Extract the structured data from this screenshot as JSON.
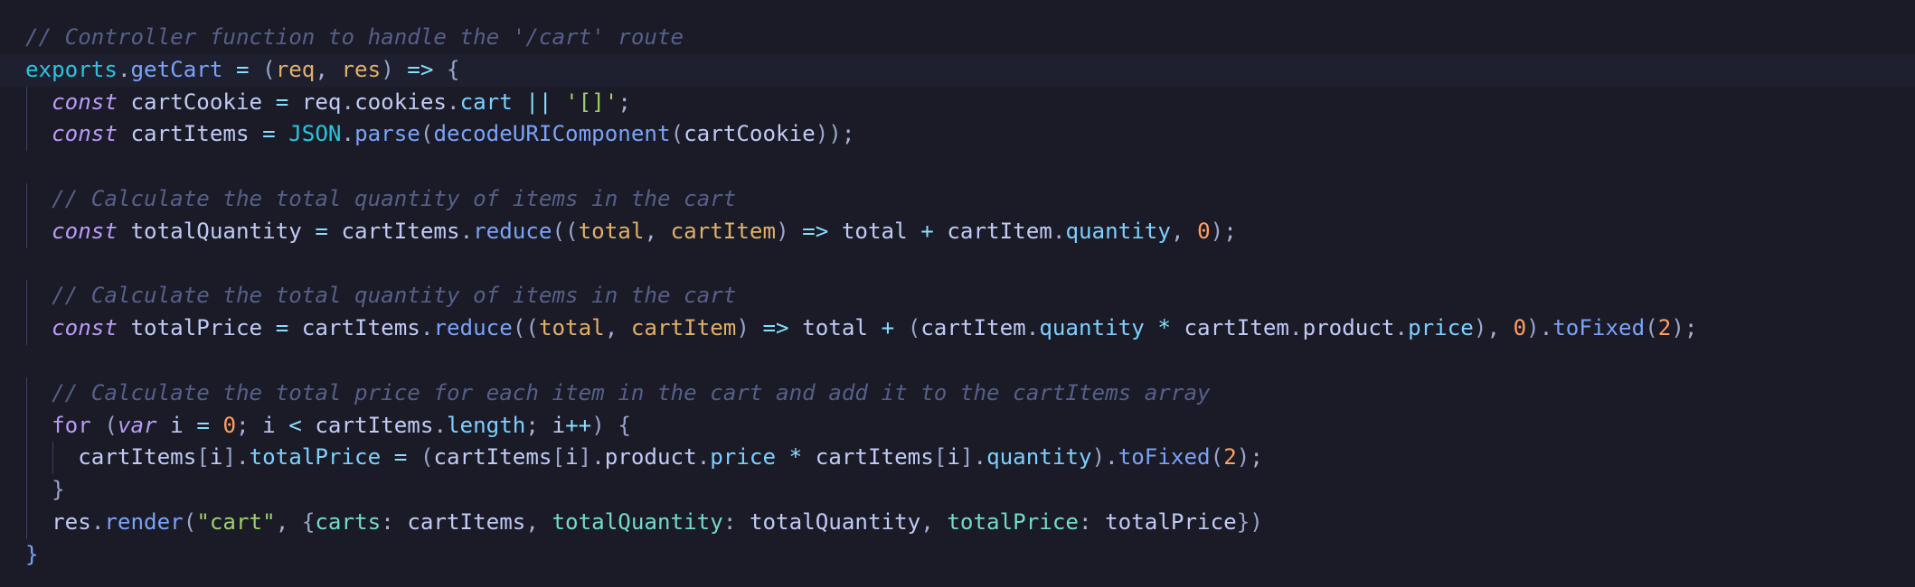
{
  "editor": {
    "language": "javascript",
    "theme_colors": {
      "background": "#1a1b26",
      "active_line": "#1e2030",
      "comment": "#565f89",
      "keyword": "#bb9af7",
      "string": "#9ece6a",
      "number": "#ff9e64",
      "function": "#7aa2f7",
      "property": "#7dcfff",
      "parameter": "#e0af68"
    },
    "lines": [
      {
        "indent": 0,
        "tokens": [
          [
            "comment",
            "// Controller function to handle the '/cart' route"
          ]
        ]
      },
      {
        "indent": 0,
        "active": true,
        "tokens": [
          [
            "exports",
            "exports"
          ],
          [
            "punct",
            "."
          ],
          [
            "func",
            "getCart"
          ],
          [
            "op",
            " = "
          ],
          [
            "bracket",
            "("
          ],
          [
            "param",
            "req"
          ],
          [
            "punct",
            ", "
          ],
          [
            "param",
            "res"
          ],
          [
            "bracket",
            ")"
          ],
          [
            "op",
            " => "
          ],
          [
            "bracket",
            "{"
          ]
        ]
      },
      {
        "indent": 1,
        "tokens": [
          [
            "keyword",
            "const"
          ],
          [
            "var",
            " cartCookie "
          ],
          [
            "op",
            "="
          ],
          [
            "var",
            " req"
          ],
          [
            "punct",
            "."
          ],
          [
            "var",
            "cookies"
          ],
          [
            "punct",
            "."
          ],
          [
            "prop",
            "cart"
          ],
          [
            "op",
            " || "
          ],
          [
            "string",
            "'[]'"
          ],
          [
            "punct",
            ";"
          ]
        ]
      },
      {
        "indent": 1,
        "tokens": [
          [
            "keyword",
            "const"
          ],
          [
            "var",
            " cartItems "
          ],
          [
            "op",
            "="
          ],
          [
            "var",
            " "
          ],
          [
            "builtin",
            "JSON"
          ],
          [
            "punct",
            "."
          ],
          [
            "func",
            "parse"
          ],
          [
            "bracket",
            "("
          ],
          [
            "func",
            "decodeURIComponent"
          ],
          [
            "bracket",
            "("
          ],
          [
            "var",
            "cartCookie"
          ],
          [
            "bracket",
            "))"
          ],
          [
            "punct",
            ";"
          ]
        ]
      },
      {
        "indent": 0,
        "tokens": []
      },
      {
        "indent": 1,
        "tokens": [
          [
            "comment",
            "// Calculate the total quantity of items in the cart"
          ]
        ]
      },
      {
        "indent": 1,
        "tokens": [
          [
            "keyword",
            "const"
          ],
          [
            "var",
            " totalQuantity "
          ],
          [
            "op",
            "="
          ],
          [
            "var",
            " cartItems"
          ],
          [
            "punct",
            "."
          ],
          [
            "func",
            "reduce"
          ],
          [
            "bracket",
            "(("
          ],
          [
            "param",
            "total"
          ],
          [
            "punct",
            ", "
          ],
          [
            "param",
            "cartItem"
          ],
          [
            "bracket",
            ")"
          ],
          [
            "op",
            " => "
          ],
          [
            "var",
            "total "
          ],
          [
            "op",
            "+"
          ],
          [
            "var",
            " cartItem"
          ],
          [
            "punct",
            "."
          ],
          [
            "prop",
            "quantity"
          ],
          [
            "punct",
            ", "
          ],
          [
            "number",
            "0"
          ],
          [
            "bracket",
            ")"
          ],
          [
            "punct",
            ";"
          ]
        ]
      },
      {
        "indent": 0,
        "tokens": []
      },
      {
        "indent": 1,
        "tokens": [
          [
            "comment",
            "// Calculate the total quantity of items in the cart"
          ]
        ]
      },
      {
        "indent": 1,
        "tokens": [
          [
            "keyword",
            "const"
          ],
          [
            "var",
            " totalPrice "
          ],
          [
            "op",
            "="
          ],
          [
            "var",
            " cartItems"
          ],
          [
            "punct",
            "."
          ],
          [
            "func",
            "reduce"
          ],
          [
            "bracket",
            "(("
          ],
          [
            "param",
            "total"
          ],
          [
            "punct",
            ", "
          ],
          [
            "param",
            "cartItem"
          ],
          [
            "bracket",
            ")"
          ],
          [
            "op",
            " => "
          ],
          [
            "var",
            "total "
          ],
          [
            "op",
            "+"
          ],
          [
            "var",
            " "
          ],
          [
            "bracket",
            "("
          ],
          [
            "var",
            "cartItem"
          ],
          [
            "punct",
            "."
          ],
          [
            "prop",
            "quantity"
          ],
          [
            "op",
            " * "
          ],
          [
            "var",
            "cartItem"
          ],
          [
            "punct",
            "."
          ],
          [
            "var",
            "product"
          ],
          [
            "punct",
            "."
          ],
          [
            "prop",
            "price"
          ],
          [
            "bracket",
            ")"
          ],
          [
            "punct",
            ", "
          ],
          [
            "number",
            "0"
          ],
          [
            "bracket",
            ")"
          ],
          [
            "punct",
            "."
          ],
          [
            "func",
            "toFixed"
          ],
          [
            "bracket",
            "("
          ],
          [
            "number",
            "2"
          ],
          [
            "bracket",
            ")"
          ],
          [
            "punct",
            ";"
          ]
        ]
      },
      {
        "indent": 0,
        "tokens": []
      },
      {
        "indent": 1,
        "tokens": [
          [
            "comment",
            "// Calculate the total price for each item in the cart and add it to the cartItems array"
          ]
        ]
      },
      {
        "indent": 1,
        "tokens": [
          [
            "control",
            "for"
          ],
          [
            "var",
            " "
          ],
          [
            "bracket",
            "("
          ],
          [
            "keyword",
            "var"
          ],
          [
            "var",
            " i "
          ],
          [
            "op",
            "="
          ],
          [
            "var",
            " "
          ],
          [
            "number",
            "0"
          ],
          [
            "punct",
            ";"
          ],
          [
            "var",
            " i "
          ],
          [
            "op",
            "<"
          ],
          [
            "var",
            " cartItems"
          ],
          [
            "punct",
            "."
          ],
          [
            "prop",
            "length"
          ],
          [
            "punct",
            ";"
          ],
          [
            "var",
            " i"
          ],
          [
            "op",
            "++"
          ],
          [
            "bracket",
            ")"
          ],
          [
            "var",
            " "
          ],
          [
            "bracket",
            "{"
          ]
        ]
      },
      {
        "indent": 2,
        "tokens": [
          [
            "var",
            "cartItems"
          ],
          [
            "bracket",
            "["
          ],
          [
            "var",
            "i"
          ],
          [
            "bracket",
            "]"
          ],
          [
            "punct",
            "."
          ],
          [
            "prop",
            "totalPrice"
          ],
          [
            "op",
            " = "
          ],
          [
            "bracket",
            "("
          ],
          [
            "var",
            "cartItems"
          ],
          [
            "bracket",
            "["
          ],
          [
            "var",
            "i"
          ],
          [
            "bracket",
            "]"
          ],
          [
            "punct",
            "."
          ],
          [
            "var",
            "product"
          ],
          [
            "punct",
            "."
          ],
          [
            "prop",
            "price"
          ],
          [
            "op",
            " * "
          ],
          [
            "var",
            "cartItems"
          ],
          [
            "bracket",
            "["
          ],
          [
            "var",
            "i"
          ],
          [
            "bracket",
            "]"
          ],
          [
            "punct",
            "."
          ],
          [
            "prop",
            "quantity"
          ],
          [
            "bracket",
            ")"
          ],
          [
            "punct",
            "."
          ],
          [
            "func",
            "toFixed"
          ],
          [
            "bracket",
            "("
          ],
          [
            "number",
            "2"
          ],
          [
            "bracket",
            ")"
          ],
          [
            "punct",
            ";"
          ]
        ]
      },
      {
        "indent": 1,
        "tokens": [
          [
            "bracket",
            "}"
          ]
        ]
      },
      {
        "indent": 1,
        "tokens": [
          [
            "var",
            "res"
          ],
          [
            "punct",
            "."
          ],
          [
            "func",
            "render"
          ],
          [
            "bracket",
            "("
          ],
          [
            "string",
            "\"cart\""
          ],
          [
            "punct",
            ", "
          ],
          [
            "bracket",
            "{"
          ],
          [
            "objkey",
            "carts"
          ],
          [
            "punct",
            ": "
          ],
          [
            "var",
            "cartItems"
          ],
          [
            "punct",
            ", "
          ],
          [
            "objkey",
            "totalQuantity"
          ],
          [
            "punct",
            ": "
          ],
          [
            "var",
            "totalQuantity"
          ],
          [
            "punct",
            ", "
          ],
          [
            "objkey",
            "totalPrice"
          ],
          [
            "punct",
            ": "
          ],
          [
            "var",
            "totalPrice"
          ],
          [
            "bracket",
            "})"
          ]
        ]
      },
      {
        "indent": 0,
        "tokens": [
          [
            "func",
            "}"
          ]
        ]
      }
    ]
  }
}
